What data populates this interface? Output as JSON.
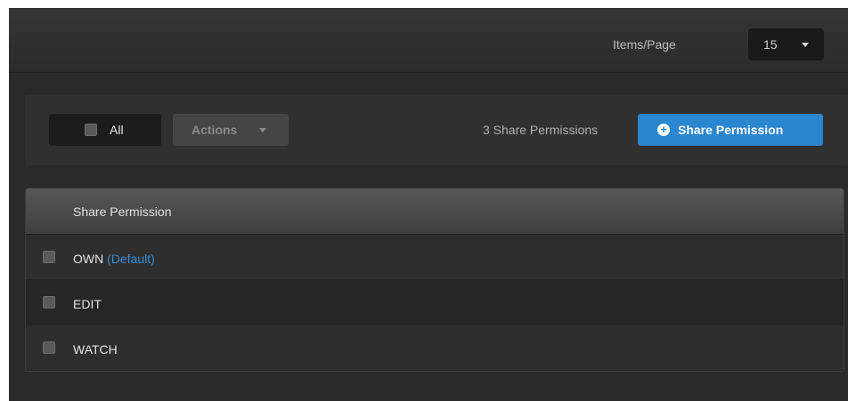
{
  "header": {
    "items_per_page_label": "Items/Page",
    "items_per_page_value": "15"
  },
  "toolbar": {
    "all_label": "All",
    "actions_label": "Actions",
    "count_text": "3 Share Permissions",
    "share_button_label": "Share Permission"
  },
  "table": {
    "column_header": "Share Permission",
    "rows": [
      {
        "name": "OWN",
        "tag": "(Default)"
      },
      {
        "name": "EDIT",
        "tag": ""
      },
      {
        "name": "WATCH",
        "tag": ""
      }
    ]
  },
  "colors": {
    "accent": "#2a86cf",
    "background": "#2a2a2a",
    "default_tag": "#3a8fd6"
  },
  "icons": [
    "chevron-down-icon",
    "plus-circle-icon",
    "checkbox-icon"
  ]
}
